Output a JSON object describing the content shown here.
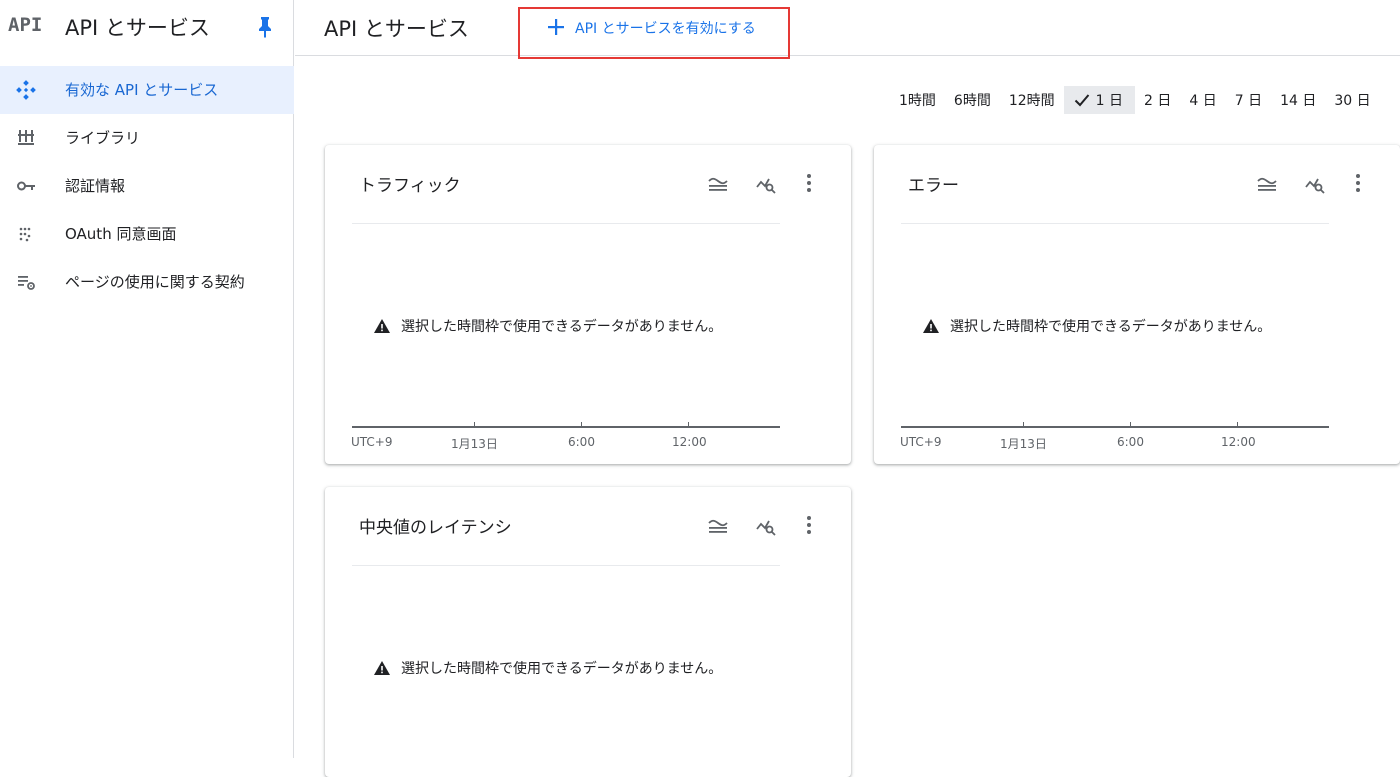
{
  "sidebar": {
    "logo": "API",
    "title": "API とサービス",
    "items": [
      {
        "label": "有効な API とサービス",
        "icon": "api-diamond-icon",
        "active": true
      },
      {
        "label": "ライブラリ",
        "icon": "library-icon",
        "active": false
      },
      {
        "label": "認証情報",
        "icon": "key-icon",
        "active": false
      },
      {
        "label": "OAuth 同意画面",
        "icon": "oauth-dots-icon",
        "active": false
      },
      {
        "label": "ページの使用に関する契約",
        "icon": "list-settings-icon",
        "active": false
      }
    ]
  },
  "header": {
    "title": "API とサービス",
    "enable_button": "API とサービスを有効にする"
  },
  "time_range": {
    "options": [
      "1時間",
      "6時間",
      "12時間",
      "1 日",
      "2 日",
      "4 日",
      "7 日",
      "14 日",
      "30 日"
    ],
    "selected": "1 日"
  },
  "cards": [
    {
      "title": "トラフィック",
      "message": "選択した時間枠で使用できるデータがありません。",
      "axis": [
        "UTC+9",
        "1月13日",
        "6:00",
        "12:00"
      ]
    },
    {
      "title": "エラー",
      "message": "選択した時間枠で使用できるデータがありません。",
      "axis": [
        "UTC+9",
        "1月13日",
        "6:00",
        "12:00"
      ]
    },
    {
      "title": "中央値のレイテンシ",
      "message": "選択した時間枠で使用できるデータがありません。",
      "axis": []
    }
  ],
  "colors": {
    "accent": "#1a73e8",
    "active_bg": "#e8f0fe",
    "highlight_border": "#e53935"
  }
}
